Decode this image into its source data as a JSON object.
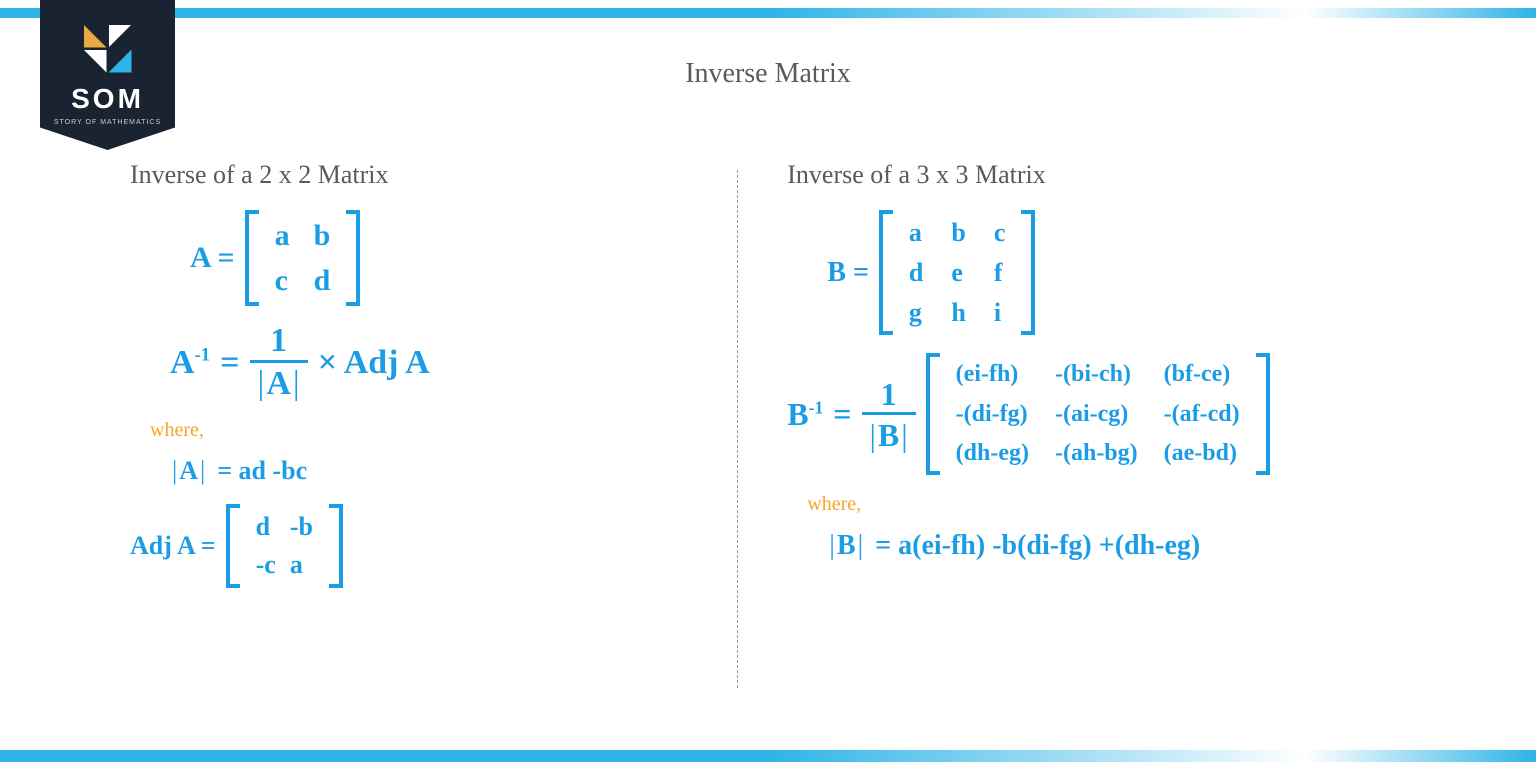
{
  "logo": {
    "name": "SOM",
    "subtitle": "STORY OF MATHEMATICS"
  },
  "title": "Inverse Matrix",
  "left": {
    "heading": "Inverse of a 2 x 2 Matrix",
    "matrixA_lhs": "A =",
    "matrixA_cells": [
      "a",
      "b",
      "c",
      "d"
    ],
    "inverseA_lhs": "A",
    "inverseA_sup": "-1",
    "equals": " = ",
    "frac_num": "1",
    "frac_den_var": "A",
    "times_adj": " × Adj A",
    "where": "where,",
    "detA_lhs": "A",
    "detA_rhs": " = ad -bc",
    "adjA_lhs": "Adj A  = ",
    "adjA_cells": [
      "d",
      "-b",
      "-c",
      "a"
    ]
  },
  "right": {
    "heading": "Inverse of a 3 x 3 Matrix",
    "matrixB_lhs": "B = ",
    "matrixB_cells": [
      "a",
      "b",
      "c",
      "d",
      "e",
      "f",
      "g",
      "h",
      "i"
    ],
    "inverseB_lhs": "B",
    "inverseB_sup": "-1",
    "equals": " = ",
    "frac_num": "1",
    "frac_den_var": "B",
    "adjB_cells": [
      "(ei-fh)",
      "-(bi-ch)",
      "(bf-ce)",
      "-(di-fg)",
      "-(ai-cg)",
      "-(af-cd)",
      "(dh-eg)",
      "-(ah-bg)",
      "(ae-bd)"
    ],
    "where": "where,",
    "detB_lhs": "B",
    "detB_rhs": " = a(ei-fh) -b(di-fg) +(dh-eg)"
  }
}
